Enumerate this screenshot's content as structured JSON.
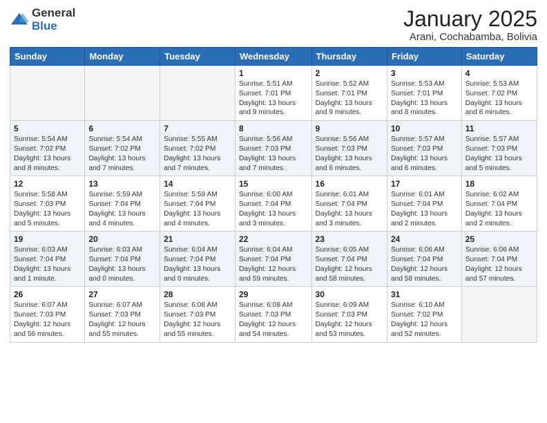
{
  "header": {
    "logo_general": "General",
    "logo_blue": "Blue",
    "month_title": "January 2025",
    "location": "Arani, Cochabamba, Bolivia"
  },
  "days_of_week": [
    "Sunday",
    "Monday",
    "Tuesday",
    "Wednesday",
    "Thursday",
    "Friday",
    "Saturday"
  ],
  "weeks": [
    [
      {
        "day": "",
        "info": ""
      },
      {
        "day": "",
        "info": ""
      },
      {
        "day": "",
        "info": ""
      },
      {
        "day": "1",
        "info": "Sunrise: 5:51 AM\nSunset: 7:01 PM\nDaylight: 13 hours\nand 9 minutes."
      },
      {
        "day": "2",
        "info": "Sunrise: 5:52 AM\nSunset: 7:01 PM\nDaylight: 13 hours\nand 9 minutes."
      },
      {
        "day": "3",
        "info": "Sunrise: 5:53 AM\nSunset: 7:01 PM\nDaylight: 13 hours\nand 8 minutes."
      },
      {
        "day": "4",
        "info": "Sunrise: 5:53 AM\nSunset: 7:02 PM\nDaylight: 13 hours\nand 8 minutes."
      }
    ],
    [
      {
        "day": "5",
        "info": "Sunrise: 5:54 AM\nSunset: 7:02 PM\nDaylight: 13 hours\nand 8 minutes."
      },
      {
        "day": "6",
        "info": "Sunrise: 5:54 AM\nSunset: 7:02 PM\nDaylight: 13 hours\nand 7 minutes."
      },
      {
        "day": "7",
        "info": "Sunrise: 5:55 AM\nSunset: 7:02 PM\nDaylight: 13 hours\nand 7 minutes."
      },
      {
        "day": "8",
        "info": "Sunrise: 5:56 AM\nSunset: 7:03 PM\nDaylight: 13 hours\nand 7 minutes."
      },
      {
        "day": "9",
        "info": "Sunrise: 5:56 AM\nSunset: 7:03 PM\nDaylight: 13 hours\nand 6 minutes."
      },
      {
        "day": "10",
        "info": "Sunrise: 5:57 AM\nSunset: 7:03 PM\nDaylight: 13 hours\nand 6 minutes."
      },
      {
        "day": "11",
        "info": "Sunrise: 5:57 AM\nSunset: 7:03 PM\nDaylight: 13 hours\nand 5 minutes."
      }
    ],
    [
      {
        "day": "12",
        "info": "Sunrise: 5:58 AM\nSunset: 7:03 PM\nDaylight: 13 hours\nand 5 minutes."
      },
      {
        "day": "13",
        "info": "Sunrise: 5:59 AM\nSunset: 7:04 PM\nDaylight: 13 hours\nand 4 minutes."
      },
      {
        "day": "14",
        "info": "Sunrise: 5:59 AM\nSunset: 7:04 PM\nDaylight: 13 hours\nand 4 minutes."
      },
      {
        "day": "15",
        "info": "Sunrise: 6:00 AM\nSunset: 7:04 PM\nDaylight: 13 hours\nand 3 minutes."
      },
      {
        "day": "16",
        "info": "Sunrise: 6:01 AM\nSunset: 7:04 PM\nDaylight: 13 hours\nand 3 minutes."
      },
      {
        "day": "17",
        "info": "Sunrise: 6:01 AM\nSunset: 7:04 PM\nDaylight: 13 hours\nand 2 minutes."
      },
      {
        "day": "18",
        "info": "Sunrise: 6:02 AM\nSunset: 7:04 PM\nDaylight: 13 hours\nand 2 minutes."
      }
    ],
    [
      {
        "day": "19",
        "info": "Sunrise: 6:03 AM\nSunset: 7:04 PM\nDaylight: 13 hours\nand 1 minute."
      },
      {
        "day": "20",
        "info": "Sunrise: 6:03 AM\nSunset: 7:04 PM\nDaylight: 13 hours\nand 0 minutes."
      },
      {
        "day": "21",
        "info": "Sunrise: 6:04 AM\nSunset: 7:04 PM\nDaylight: 13 hours\nand 0 minutes."
      },
      {
        "day": "22",
        "info": "Sunrise: 6:04 AM\nSunset: 7:04 PM\nDaylight: 12 hours\nand 59 minutes."
      },
      {
        "day": "23",
        "info": "Sunrise: 6:05 AM\nSunset: 7:04 PM\nDaylight: 12 hours\nand 58 minutes."
      },
      {
        "day": "24",
        "info": "Sunrise: 6:06 AM\nSunset: 7:04 PM\nDaylight: 12 hours\nand 58 minutes."
      },
      {
        "day": "25",
        "info": "Sunrise: 6:06 AM\nSunset: 7:04 PM\nDaylight: 12 hours\nand 57 minutes."
      }
    ],
    [
      {
        "day": "26",
        "info": "Sunrise: 6:07 AM\nSunset: 7:03 PM\nDaylight: 12 hours\nand 56 minutes."
      },
      {
        "day": "27",
        "info": "Sunrise: 6:07 AM\nSunset: 7:03 PM\nDaylight: 12 hours\nand 55 minutes."
      },
      {
        "day": "28",
        "info": "Sunrise: 6:08 AM\nSunset: 7:03 PM\nDaylight: 12 hours\nand 55 minutes."
      },
      {
        "day": "29",
        "info": "Sunrise: 6:08 AM\nSunset: 7:03 PM\nDaylight: 12 hours\nand 54 minutes."
      },
      {
        "day": "30",
        "info": "Sunrise: 6:09 AM\nSunset: 7:03 PM\nDaylight: 12 hours\nand 53 minutes."
      },
      {
        "day": "31",
        "info": "Sunrise: 6:10 AM\nSunset: 7:02 PM\nDaylight: 12 hours\nand 52 minutes."
      },
      {
        "day": "",
        "info": ""
      }
    ]
  ]
}
